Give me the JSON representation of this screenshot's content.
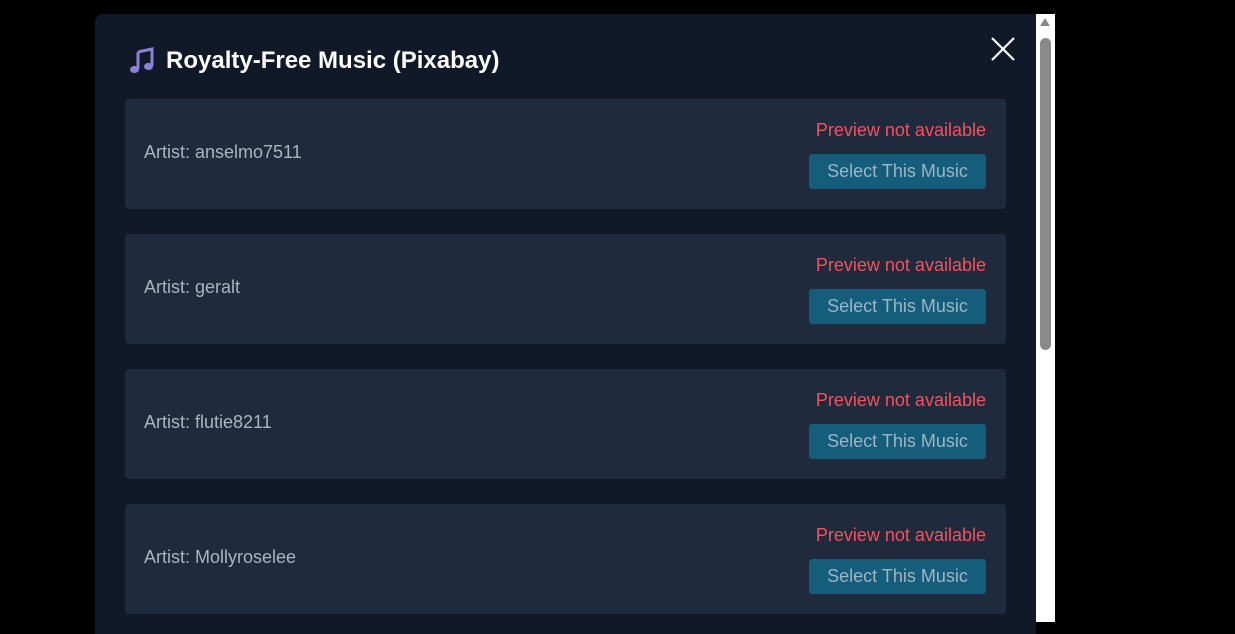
{
  "modal": {
    "title": "Royalty-Free Music (Pixabay)",
    "icon": "music-note-icon",
    "close_icon": "close-icon"
  },
  "colors": {
    "background": "#111827",
    "card": "#1f2a3c",
    "error_text": "#f4525e",
    "button": "#145e7c",
    "icon_accent": "#8b7fd6"
  },
  "items": [
    {
      "artist": "Artist: anselmo7511",
      "status": "Preview not available",
      "button_label": "Select This Music"
    },
    {
      "artist": "Artist: geralt",
      "status": "Preview not available",
      "button_label": "Select This Music"
    },
    {
      "artist": "Artist: flutie8211",
      "status": "Preview not available",
      "button_label": "Select This Music"
    },
    {
      "artist": "Artist: Mollyroselee",
      "status": "Preview not available",
      "button_label": "Select This Music"
    }
  ]
}
